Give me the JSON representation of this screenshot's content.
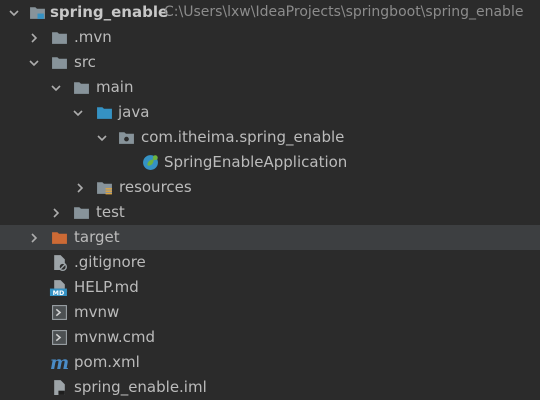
{
  "project": {
    "name": "spring_enable",
    "path": "C:\\Users\\lxw\\IdeaProjects\\springboot\\spring_enable"
  },
  "tree": {
    "mvn": ".mvn",
    "src": "src",
    "main": "main",
    "java": "java",
    "package": "com.itheima.spring_enable",
    "app_class": "SpringEnableApplication",
    "resources": "resources",
    "test": "test",
    "target": "target",
    "gitignore": ".gitignore",
    "help": "HELP.md",
    "mvnw": "mvnw",
    "mvnw_cmd": "mvnw.cmd",
    "pom": "pom.xml",
    "iml": "spring_enable.iml"
  },
  "icons": {
    "help_badge": "MD",
    "pom_glyph": "m"
  },
  "colors": {
    "background": "#2b2b2b",
    "selected_row": "#3d3f41",
    "folder": "#87939a",
    "source_folder": "#3592c4",
    "excluded_folder": "#cc6a35",
    "text": "#bbbbbb",
    "path_text": "#8c8c8c"
  }
}
